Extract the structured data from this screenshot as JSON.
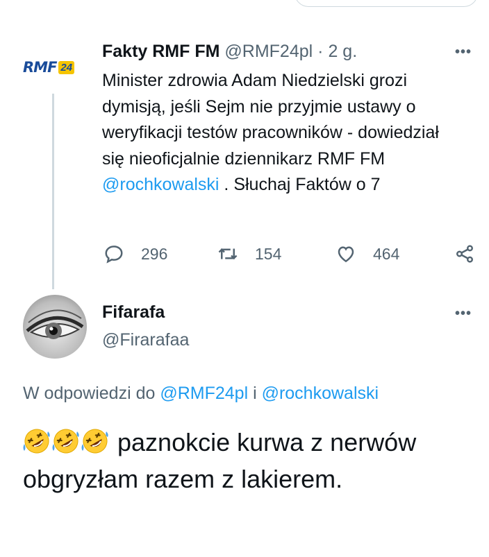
{
  "tweet": {
    "author_name": "Fakty RMF FM",
    "author_handle": "@RMF24pl",
    "separator": "·",
    "time": "2 g.",
    "logo_text": "RMF",
    "logo_number": "24",
    "more": "•••",
    "text_before_mention": "Minister zdrowia Adam Niedzielski grozi dymisją, jeśli Sejm nie przyjmie ustawy o weryfikacji testów pracowników - dowiedział się nieoficjalnie dziennikarz RMF FM ",
    "mention": "@rochkowalski",
    "text_after_mention": " . Słuchaj Faktów o 7",
    "replies": "296",
    "retweets": "154",
    "likes": "464",
    "icons": [
      "comment-icon",
      "retweet-icon",
      "heart-icon",
      "share-icon"
    ]
  },
  "reply": {
    "author_name": "Fifarafa",
    "author_handle": "@Firarafaa",
    "more": "•••",
    "reply_prefix": "W odpowiedzi do ",
    "reply_mention_1": "@RMF24pl",
    "reply_joiner": " i ",
    "reply_mention_2": "@rochkowalski",
    "emojis": [
      "rolling-on-floor-laughing",
      "rolling-on-floor-laughing",
      "rolling-on-floor-laughing"
    ],
    "text": "paznokcie kurwa z nerwów obgryzłam razem z lakierem."
  },
  "colors": {
    "link": "#1d9bf0",
    "secondary": "#536471",
    "text": "#0f1419"
  }
}
